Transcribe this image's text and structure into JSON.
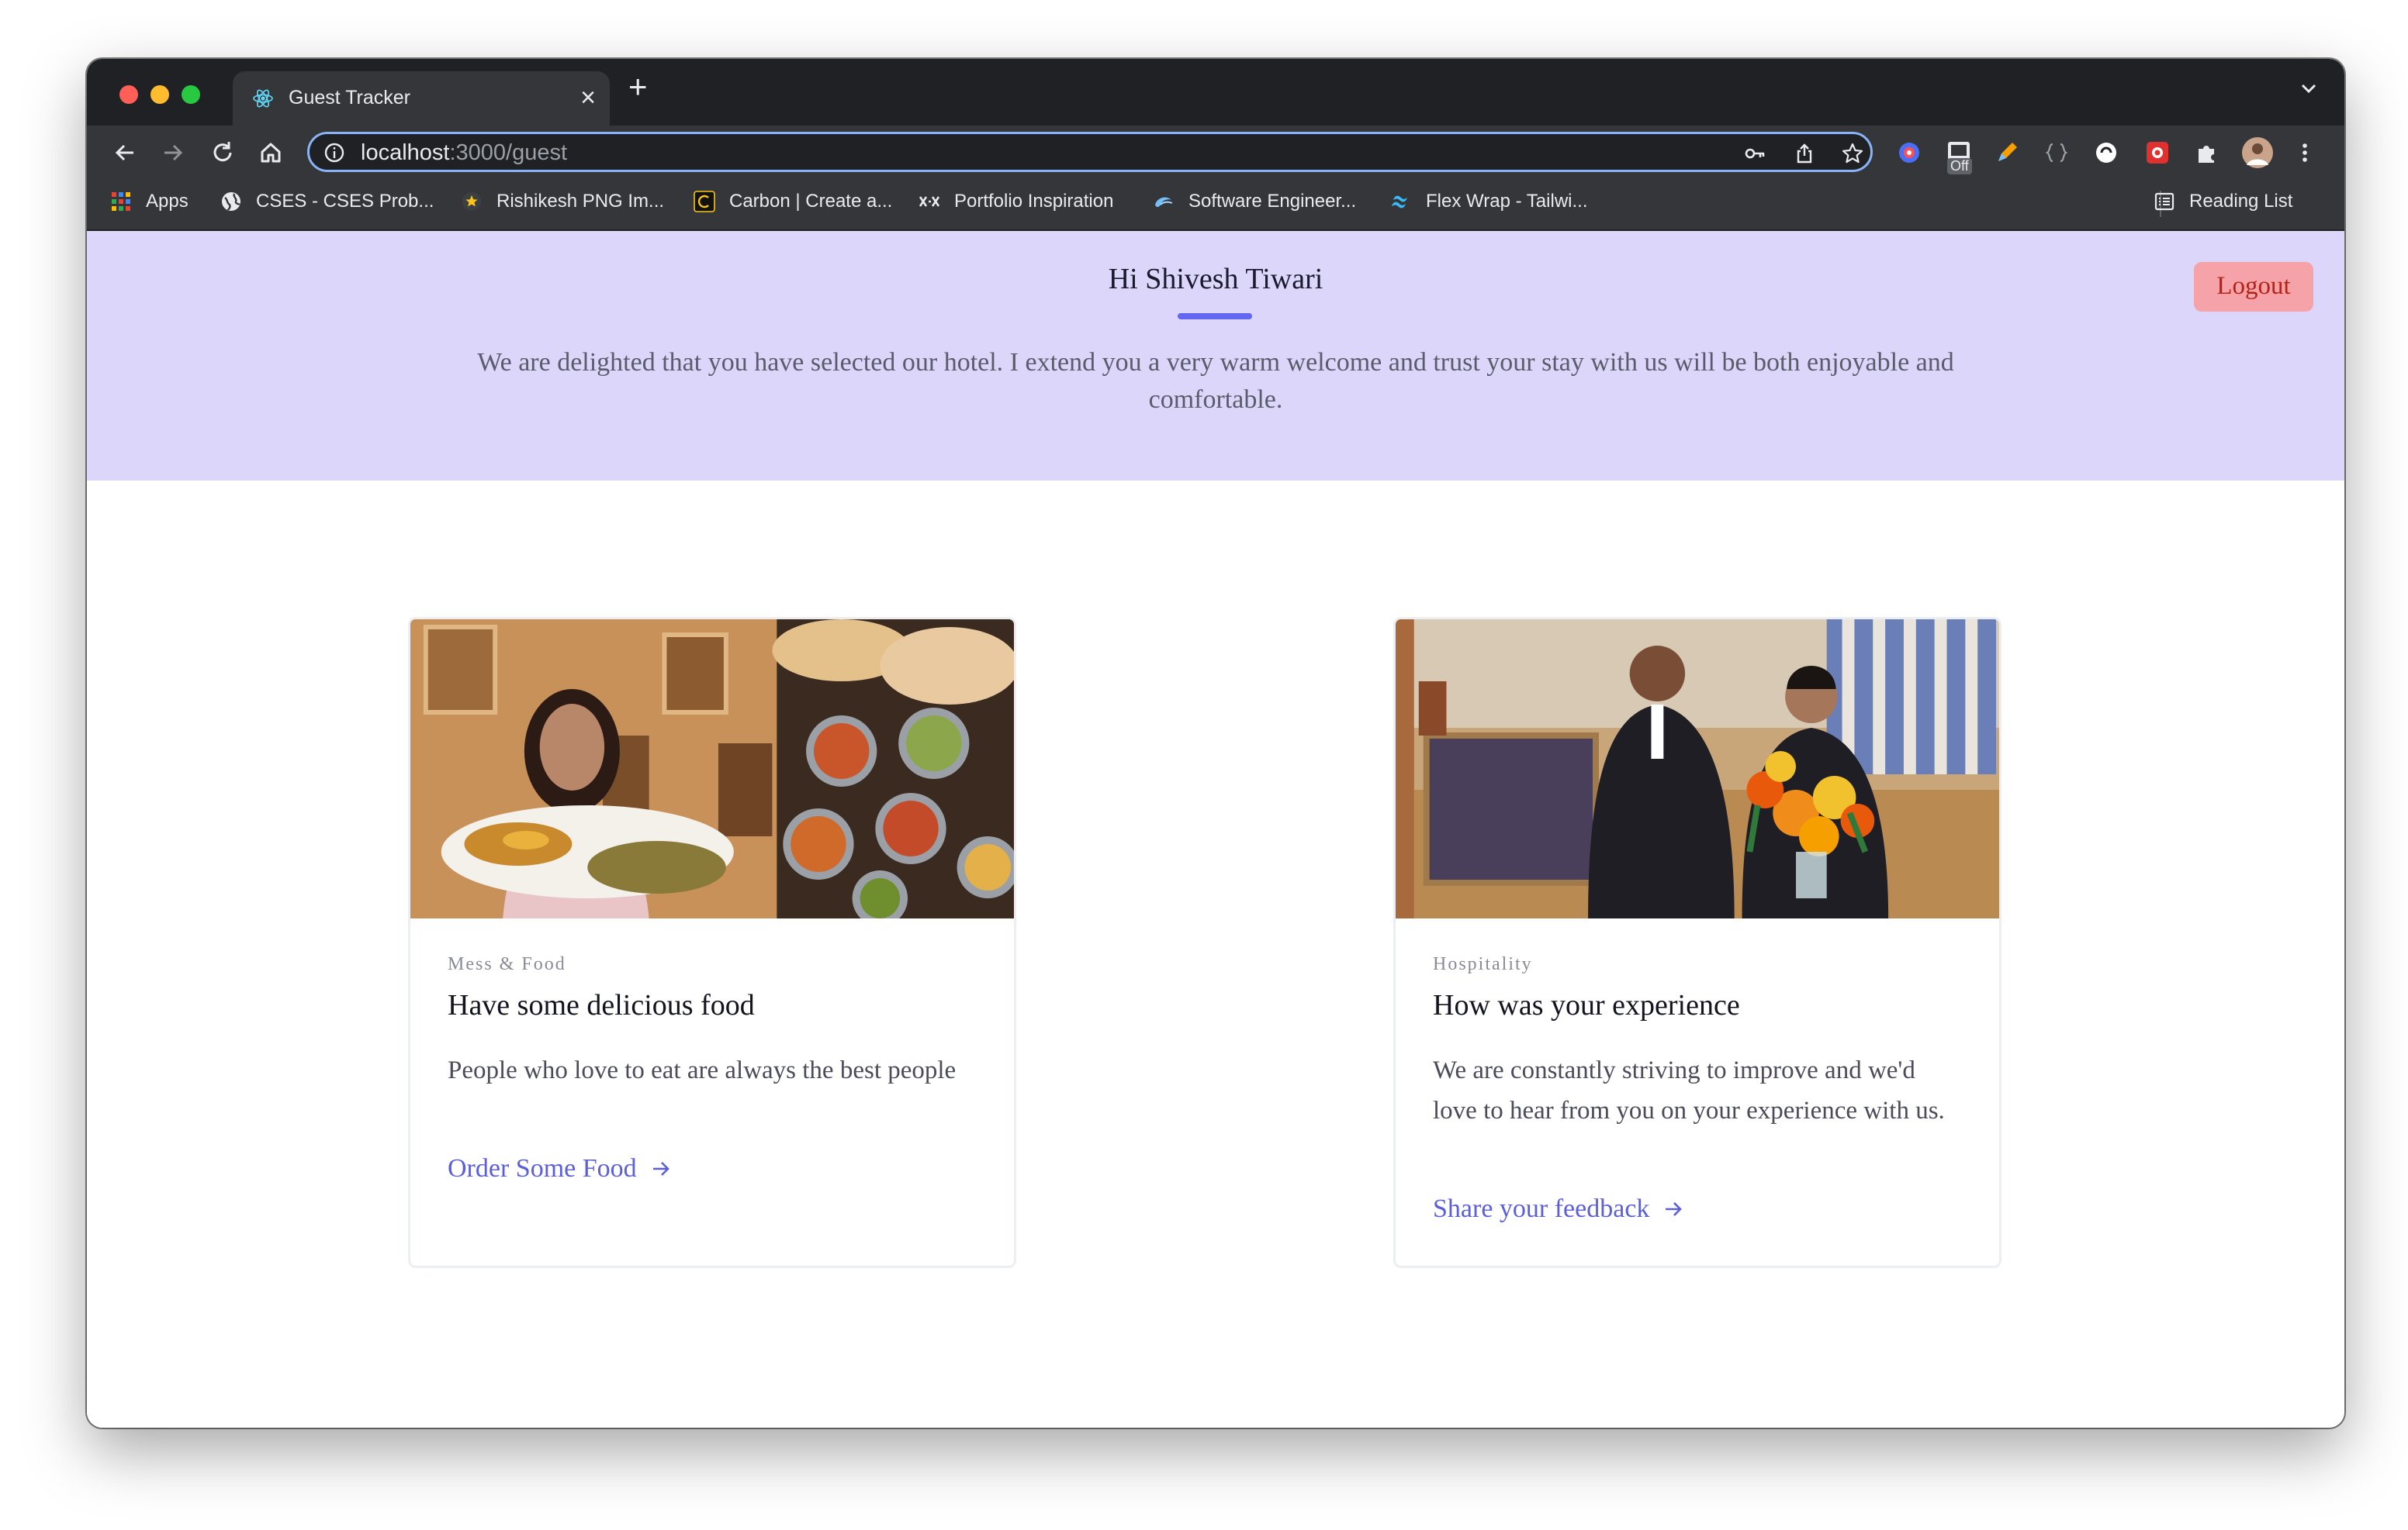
{
  "browser": {
    "tab_title": "Guest Tracker",
    "tab_close": "×",
    "new_tab": "+",
    "url_host": "localhost",
    "url_path": ":3000/guest",
    "bookmarks": [
      {
        "label": "Apps",
        "icon": "apps-grid-icon"
      },
      {
        "label": "CSES - CSES Prob...",
        "icon": "globe-icon"
      },
      {
        "label": "Rishikesh PNG Im...",
        "icon": "star-icon"
      },
      {
        "label": "Carbon | Create a...",
        "icon": "carbon-icon"
      },
      {
        "label": "Portfolio Inspiration",
        "icon": "portfolio-icon"
      },
      {
        "label": "Software Engineer...",
        "icon": "swirl-icon"
      },
      {
        "label": "Flex Wrap - Tailwi...",
        "icon": "tailwind-icon"
      }
    ],
    "reading_list": "Reading List",
    "extension_badge": "Off"
  },
  "header": {
    "greeting": "Hi Shivesh Tiwari",
    "welcome_text": "We are delighted that you have selected our hotel. I extend you a very warm welcome and trust your stay with us will be both enjoyable and comfortable.",
    "logout_label": "Logout"
  },
  "cards": [
    {
      "category": "Mess & Food",
      "title": "Have some delicious food",
      "body": "People who love to eat are always the best people",
      "link": "Order Some Food"
    },
    {
      "category": "Hospitality",
      "title": "How was your experience",
      "body": "We are constantly striving to improve and we'd love to hear from you on your experience with us.",
      "link": "Share your feedback"
    }
  ],
  "colors": {
    "hero_background": "#dcd6fa",
    "accent": "#6366f1",
    "link": "#5b5fdc",
    "logout_background": "#f5a3a8",
    "logout_text": "#b42318"
  }
}
